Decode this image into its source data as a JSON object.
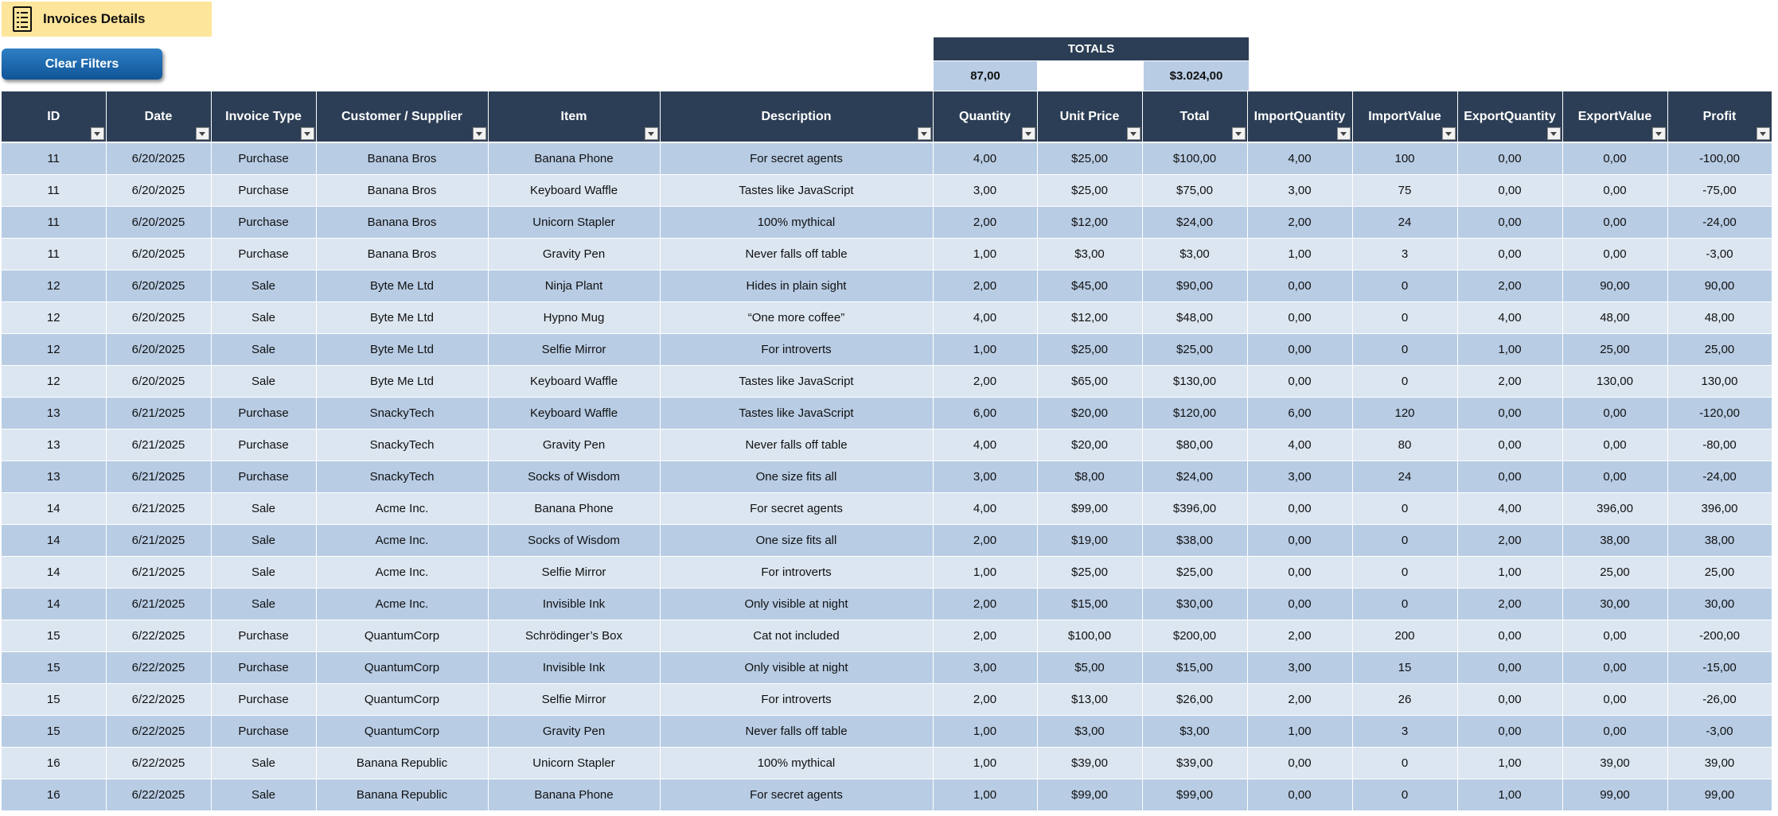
{
  "sheet": {
    "title": "Invoices Details",
    "title_icon": "receipt-list-icon",
    "clear_filters_label": "Clear Filters"
  },
  "totals": {
    "label": "TOTALS",
    "quantity": "87,00",
    "total": "$3.024,00"
  },
  "colors": {
    "header_bg": "#2c3e55",
    "row_dark": "#b8cce4",
    "row_light": "#dce6f1",
    "title_bg": "#fde59b",
    "button_blue": "#1a66ad"
  },
  "table": {
    "columns": [
      "ID",
      "Date",
      "Invoice Type",
      "Customer / Supplier",
      "Item",
      "Description",
      "Quantity",
      "Unit Price",
      "Total",
      "ImportQuantity",
      "ImportValue",
      "ExportQuantity",
      "ExportValue",
      "Profit"
    ],
    "rows": [
      [
        "11",
        "6/20/2025",
        "Purchase",
        "Banana Bros",
        "Banana Phone",
        "For secret agents",
        "4,00",
        "$25,00",
        "$100,00",
        "4,00",
        "100",
        "0,00",
        "0,00",
        "-100,00"
      ],
      [
        "11",
        "6/20/2025",
        "Purchase",
        "Banana Bros",
        "Keyboard Waffle",
        "Tastes like JavaScript",
        "3,00",
        "$25,00",
        "$75,00",
        "3,00",
        "75",
        "0,00",
        "0,00",
        "-75,00"
      ],
      [
        "11",
        "6/20/2025",
        "Purchase",
        "Banana Bros",
        "Unicorn Stapler",
        "100% mythical",
        "2,00",
        "$12,00",
        "$24,00",
        "2,00",
        "24",
        "0,00",
        "0,00",
        "-24,00"
      ],
      [
        "11",
        "6/20/2025",
        "Purchase",
        "Banana Bros",
        "Gravity Pen",
        "Never falls off table",
        "1,00",
        "$3,00",
        "$3,00",
        "1,00",
        "3",
        "0,00",
        "0,00",
        "-3,00"
      ],
      [
        "12",
        "6/20/2025",
        "Sale",
        "Byte Me Ltd",
        "Ninja Plant",
        "Hides in plain sight",
        "2,00",
        "$45,00",
        "$90,00",
        "0,00",
        "0",
        "2,00",
        "90,00",
        "90,00"
      ],
      [
        "12",
        "6/20/2025",
        "Sale",
        "Byte Me Ltd",
        "Hypno Mug",
        "“One more coffee”",
        "4,00",
        "$12,00",
        "$48,00",
        "0,00",
        "0",
        "4,00",
        "48,00",
        "48,00"
      ],
      [
        "12",
        "6/20/2025",
        "Sale",
        "Byte Me Ltd",
        "Selfie Mirror",
        "For introverts",
        "1,00",
        "$25,00",
        "$25,00",
        "0,00",
        "0",
        "1,00",
        "25,00",
        "25,00"
      ],
      [
        "12",
        "6/20/2025",
        "Sale",
        "Byte Me Ltd",
        "Keyboard Waffle",
        "Tastes like JavaScript",
        "2,00",
        "$65,00",
        "$130,00",
        "0,00",
        "0",
        "2,00",
        "130,00",
        "130,00"
      ],
      [
        "13",
        "6/21/2025",
        "Purchase",
        "SnackyTech",
        "Keyboard Waffle",
        "Tastes like JavaScript",
        "6,00",
        "$20,00",
        "$120,00",
        "6,00",
        "120",
        "0,00",
        "0,00",
        "-120,00"
      ],
      [
        "13",
        "6/21/2025",
        "Purchase",
        "SnackyTech",
        "Gravity Pen",
        "Never falls off table",
        "4,00",
        "$20,00",
        "$80,00",
        "4,00",
        "80",
        "0,00",
        "0,00",
        "-80,00"
      ],
      [
        "13",
        "6/21/2025",
        "Purchase",
        "SnackyTech",
        "Socks of Wisdom",
        "One size fits all",
        "3,00",
        "$8,00",
        "$24,00",
        "3,00",
        "24",
        "0,00",
        "0,00",
        "-24,00"
      ],
      [
        "14",
        "6/21/2025",
        "Sale",
        "Acme Inc.",
        "Banana Phone",
        "For secret agents",
        "4,00",
        "$99,00",
        "$396,00",
        "0,00",
        "0",
        "4,00",
        "396,00",
        "396,00"
      ],
      [
        "14",
        "6/21/2025",
        "Sale",
        "Acme Inc.",
        "Socks of Wisdom",
        "One size fits all",
        "2,00",
        "$19,00",
        "$38,00",
        "0,00",
        "0",
        "2,00",
        "38,00",
        "38,00"
      ],
      [
        "14",
        "6/21/2025",
        "Sale",
        "Acme Inc.",
        "Selfie Mirror",
        "For introverts",
        "1,00",
        "$25,00",
        "$25,00",
        "0,00",
        "0",
        "1,00",
        "25,00",
        "25,00"
      ],
      [
        "14",
        "6/21/2025",
        "Sale",
        "Acme Inc.",
        "Invisible Ink",
        "Only visible at night",
        "2,00",
        "$15,00",
        "$30,00",
        "0,00",
        "0",
        "2,00",
        "30,00",
        "30,00"
      ],
      [
        "15",
        "6/22/2025",
        "Purchase",
        "QuantumCorp",
        "Schrödinger’s Box",
        "Cat not included",
        "2,00",
        "$100,00",
        "$200,00",
        "2,00",
        "200",
        "0,00",
        "0,00",
        "-200,00"
      ],
      [
        "15",
        "6/22/2025",
        "Purchase",
        "QuantumCorp",
        "Invisible Ink",
        "Only visible at night",
        "3,00",
        "$5,00",
        "$15,00",
        "3,00",
        "15",
        "0,00",
        "0,00",
        "-15,00"
      ],
      [
        "15",
        "6/22/2025",
        "Purchase",
        "QuantumCorp",
        "Selfie Mirror",
        "For introverts",
        "2,00",
        "$13,00",
        "$26,00",
        "2,00",
        "26",
        "0,00",
        "0,00",
        "-26,00"
      ],
      [
        "15",
        "6/22/2025",
        "Purchase",
        "QuantumCorp",
        "Gravity Pen",
        "Never falls off table",
        "1,00",
        "$3,00",
        "$3,00",
        "1,00",
        "3",
        "0,00",
        "0,00",
        "-3,00"
      ],
      [
        "16",
        "6/22/2025",
        "Sale",
        "Banana Republic",
        "Unicorn Stapler",
        "100% mythical",
        "1,00",
        "$39,00",
        "$39,00",
        "0,00",
        "0",
        "1,00",
        "39,00",
        "39,00"
      ],
      [
        "16",
        "6/22/2025",
        "Sale",
        "Banana Republic",
        "Banana Phone",
        "For secret agents",
        "1,00",
        "$99,00",
        "$99,00",
        "0,00",
        "0",
        "1,00",
        "99,00",
        "99,00"
      ]
    ]
  }
}
